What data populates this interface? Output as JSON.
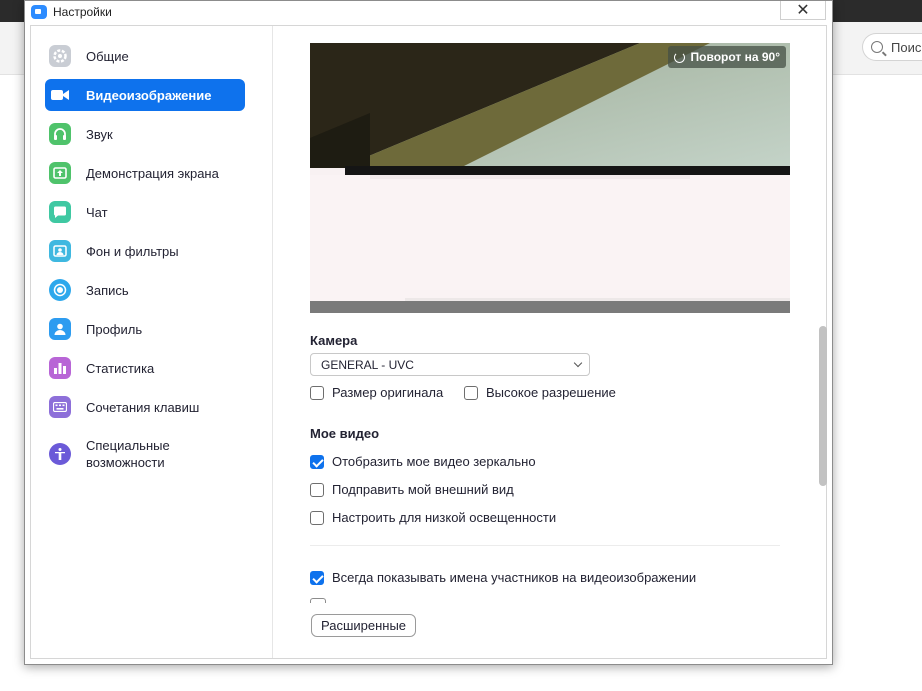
{
  "background": {
    "search_label": "Поис"
  },
  "window": {
    "title": "Настройки",
    "close_glyph": "✕"
  },
  "sidebar": {
    "items": [
      {
        "label": "Общие",
        "icon": "gear-icon",
        "color": "#bfc4cc"
      },
      {
        "label": "Видеоизображение",
        "icon": "video-camera-icon",
        "color": "#ffffff",
        "active": true
      },
      {
        "label": "Звук",
        "icon": "headphones-icon",
        "color": "#4fc36b"
      },
      {
        "label": "Демонстрация экрана",
        "icon": "screen-share-icon",
        "color": "#4fc36b"
      },
      {
        "label": "Чат",
        "icon": "chat-bubble-icon",
        "color": "#3fc8a2"
      },
      {
        "label": "Фон и фильтры",
        "icon": "background-person-icon",
        "color": "#3fb8e0"
      },
      {
        "label": "Запись",
        "icon": "record-icon",
        "color": "#2d9cf0"
      },
      {
        "label": "Профиль",
        "icon": "profile-icon",
        "color": "#2d9cf0"
      },
      {
        "label": "Статистика",
        "icon": "statistics-icon",
        "color": "#b865d6"
      },
      {
        "label": "Сочетания клавиш",
        "icon": "keyboard-icon",
        "color": "#8d6fd9"
      },
      {
        "label": "Специальные возможности",
        "icon": "accessibility-icon",
        "color": "#6b5ad8"
      }
    ]
  },
  "video": {
    "rotate_label": "Поворот на 90°",
    "camera_section": "Камера",
    "camera_value": "GENERAL - UVC",
    "original_size": "Размер оригинала",
    "hd": "Высокое разрешение",
    "my_video_section": "Мое видео",
    "mirror": "Отобразить мое видео зеркально",
    "touch_up": "Подправить мой внешний вид",
    "low_light": "Настроить для низкой освещенности",
    "always_show_names": "Всегда показывать имена участников на видеоизображении",
    "advanced_button": "Расширенные",
    "checks": {
      "original_size": false,
      "hd": false,
      "mirror": true,
      "touch_up": false,
      "low_light": false,
      "always_show_names": true
    }
  },
  "colors": {
    "accent": "#0e72ed"
  }
}
